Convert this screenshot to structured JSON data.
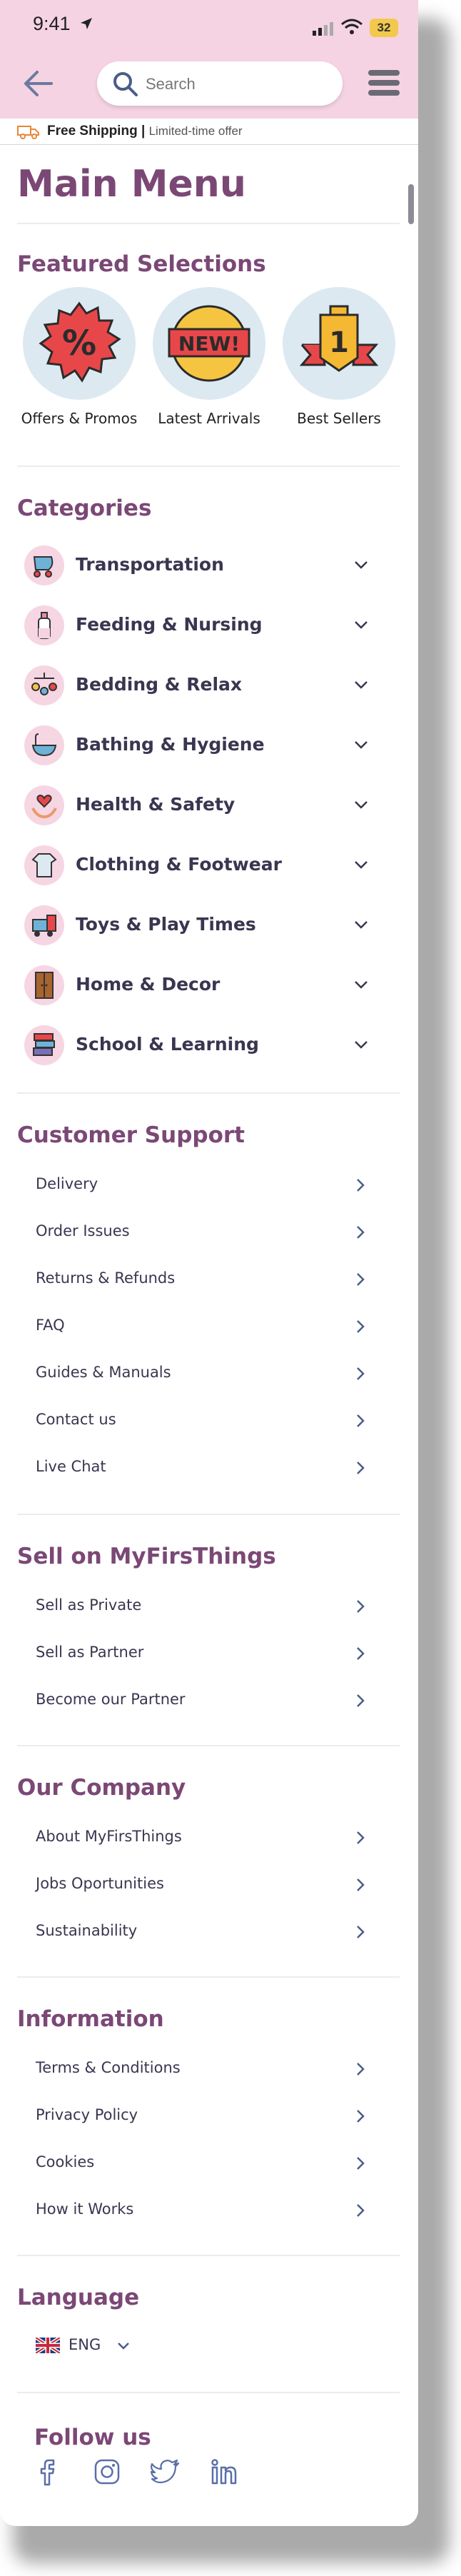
{
  "status_bar": {
    "time": "9:41",
    "battery": "32"
  },
  "search": {
    "placeholder": "Search"
  },
  "shipping": {
    "title": "Free Shipping",
    "separator": "|",
    "subtitle": "Limited-time offer"
  },
  "main_title": "Main Menu",
  "featured": {
    "title": "Featured Selections",
    "items": [
      {
        "label": "Offers & Promos",
        "icon": "percent-badge-icon"
      },
      {
        "label": "Latest Arrivals",
        "icon": "new-badge-icon"
      },
      {
        "label": "Best Sellers",
        "icon": "first-place-medal-icon"
      }
    ]
  },
  "categories": {
    "title": "Categories",
    "items": [
      {
        "label": "Transportation",
        "icon": "stroller-icon"
      },
      {
        "label": "Feeding & Nursing",
        "icon": "baby-bottle-icon"
      },
      {
        "label": "Bedding & Relax",
        "icon": "crib-mobile-icon"
      },
      {
        "label": "Bathing & Hygiene",
        "icon": "bathtub-icon"
      },
      {
        "label": "Health & Safety",
        "icon": "heart-hands-icon"
      },
      {
        "label": "Clothing & Footwear",
        "icon": "onesie-icon"
      },
      {
        "label": "Toys & Play Times",
        "icon": "toy-train-icon"
      },
      {
        "label": "Home & Decor",
        "icon": "wardrobe-icon"
      },
      {
        "label": "School & Learning",
        "icon": "books-icon"
      }
    ]
  },
  "customer_support": {
    "title": "Customer Support",
    "items": [
      "Delivery",
      "Order Issues",
      "Returns & Refunds",
      "FAQ",
      "Guides & Manuals",
      "Contact us",
      "Live Chat"
    ]
  },
  "sell": {
    "title": "Sell on MyFirsThings",
    "items": [
      "Sell as Private",
      "Sell as Partner",
      "Become our Partner"
    ]
  },
  "company": {
    "title": "Our Company",
    "items": [
      "About MyFirsThings",
      "Jobs Oportunities",
      "Sustainability"
    ]
  },
  "information": {
    "title": "Information",
    "items": [
      "Terms & Conditions",
      "Privacy Policy",
      "Cookies",
      "How it Works"
    ]
  },
  "language": {
    "title": "Language",
    "selected": "ENG"
  },
  "follow": {
    "title": "Follow us",
    "icons": [
      "facebook-icon",
      "instagram-icon",
      "twitter-icon",
      "linkedin-icon"
    ]
  },
  "colors": {
    "topbar": "#f5d3e3",
    "heading": "#7b4876",
    "accent": "#5a6ea8"
  }
}
